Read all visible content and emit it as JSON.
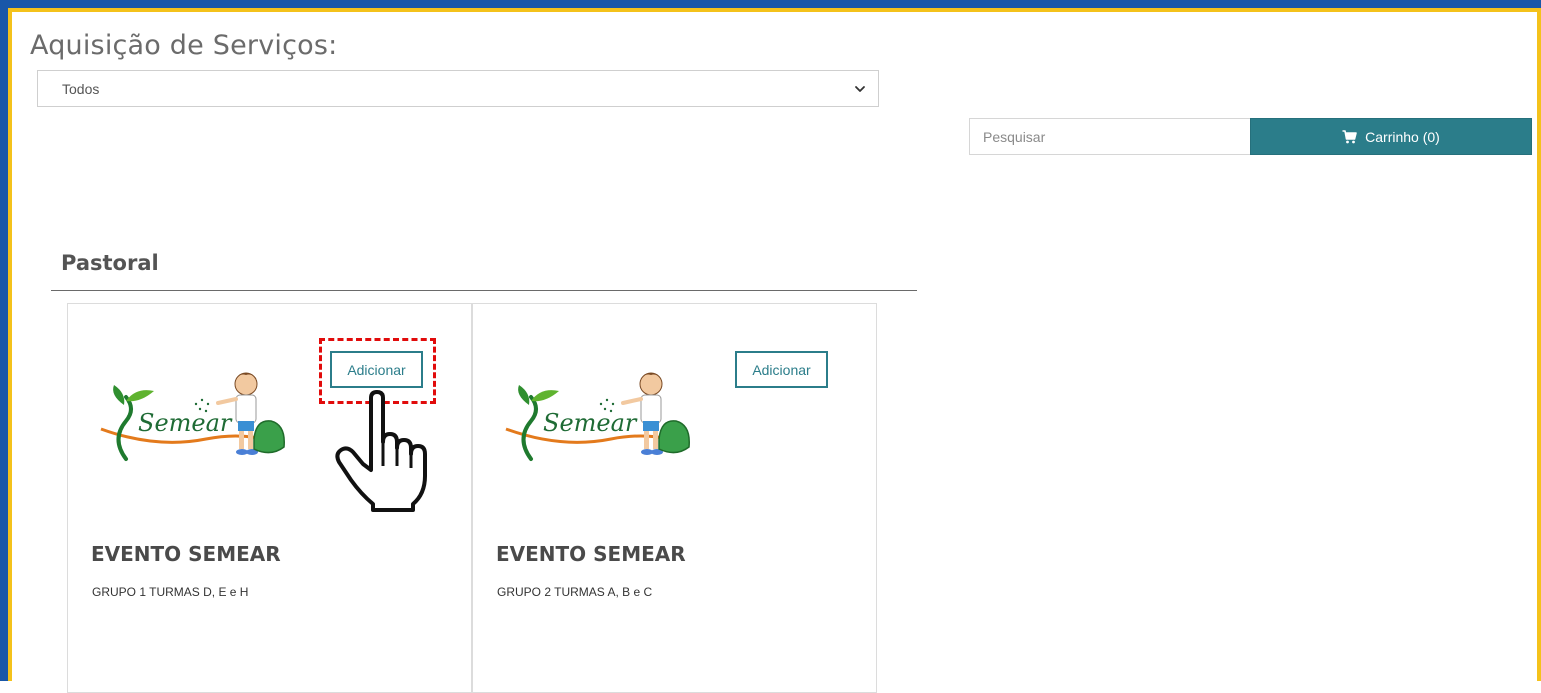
{
  "page": {
    "title": "Aquisição de Serviços:"
  },
  "filter": {
    "selected": "Todos"
  },
  "search": {
    "placeholder": "Pesquisar"
  },
  "cart": {
    "label": "Carrinho (0)"
  },
  "section": {
    "title": "Pastoral"
  },
  "products": [
    {
      "title": "EVENTO SEMEAR",
      "description": "GRUPO 1 TURMAS D, E e H",
      "add_label": "Adicionar",
      "logo_text": "Semear"
    },
    {
      "title": "EVENTO SEMEAR",
      "description": "GRUPO 2 TURMAS A, B e C",
      "add_label": "Adicionar",
      "logo_text": "Semear"
    }
  ],
  "colors": {
    "frame_blue": "#1957a8",
    "frame_yellow": "#f4c21b",
    "accent_teal": "#2b7d8a",
    "highlight_red": "#e10b0b"
  }
}
